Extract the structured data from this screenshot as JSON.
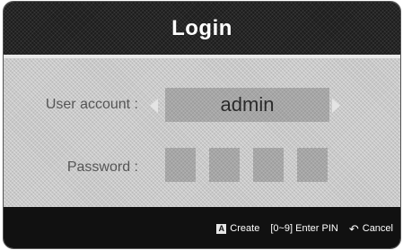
{
  "dialog": {
    "title": "Login"
  },
  "form": {
    "user_account_label": "User account :",
    "user_account_value": "admin",
    "password_label": "Password :",
    "pin_slots": 4
  },
  "footer": {
    "create_key": "A",
    "create_label": "Create",
    "pin_hint": "[0~9] Enter PIN",
    "cancel_icon": "return-arrow-icon",
    "cancel_label": "Cancel"
  }
}
